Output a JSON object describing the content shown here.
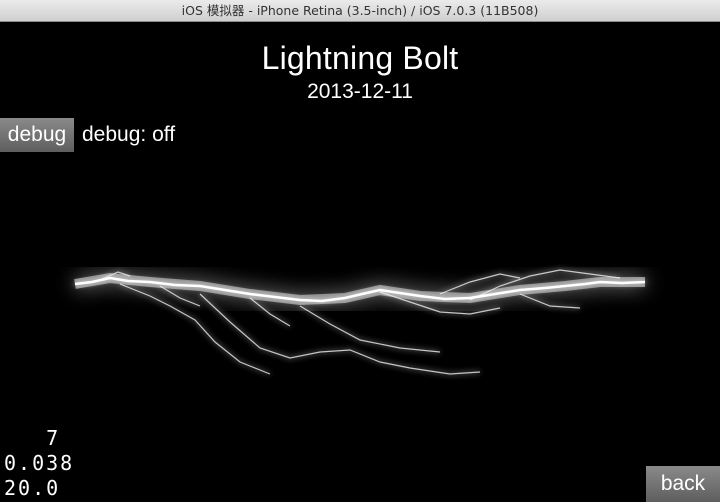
{
  "window": {
    "title": "iOS 模拟器 - iPhone Retina (3.5-inch) / iOS 7.0.3 (11B508)"
  },
  "app": {
    "title": "Lightning Bolt",
    "date": "2013-12-11",
    "debug_button_label": "debug",
    "debug_status": "debug: off",
    "back_button_label": "back"
  },
  "stats": {
    "line1": "   7",
    "line2": "0.038",
    "line3": "20.0"
  },
  "colors": {
    "background": "#000000",
    "text": "#ffffff",
    "button": "#6e6e6e",
    "bolt": "#ffffff"
  }
}
